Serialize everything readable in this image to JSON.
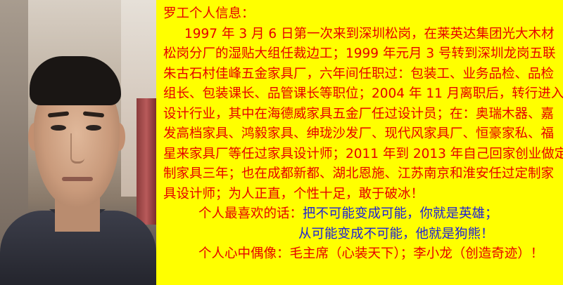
{
  "title": "罗工个人信息：",
  "bio_lines": [
    "1997 年 3 月 6 日第一次来到深圳松岗，在莱英达集团光大木材",
    "松岗分厂的湿贴大组任裁边工；1999 年元月 3 号转到深圳龙岗五联",
    "朱古石村佳峰五金家具厂，六年间任职过：包装工、业务品检、品检",
    "组长、包装课长、品管课长等职位；2004 年 11 月离职后，转行进入",
    "设计行业，其中在海德威家具五金厂任过设计员；在：奥瑞木器、嘉",
    "发高档家具、鸿毅家具、绅珑沙发厂、现代风家具厂、恒豪家私、福",
    "星来家具厂等任过家具设计师；2011 年到 2013 年自己回家创业做定",
    "制家具三年；也在成都新都、湖北恩施、江苏南京和淮安任过定制家",
    "具设计师；为人正直，个性十足，敢于破冰！"
  ],
  "motto": {
    "label": "个人最喜欢的话：",
    "line1": "把不可能变成可能，你就是英雄；",
    "line2": "从可能变成不可能，他就是狗熊！"
  },
  "idols": "个人心中偶像：毛主席（心装天下）；李小龙（创造奇迹）！",
  "colors": {
    "background": "#ffff00",
    "text_red": "#e60000",
    "text_blue": "#1f1fd6"
  }
}
